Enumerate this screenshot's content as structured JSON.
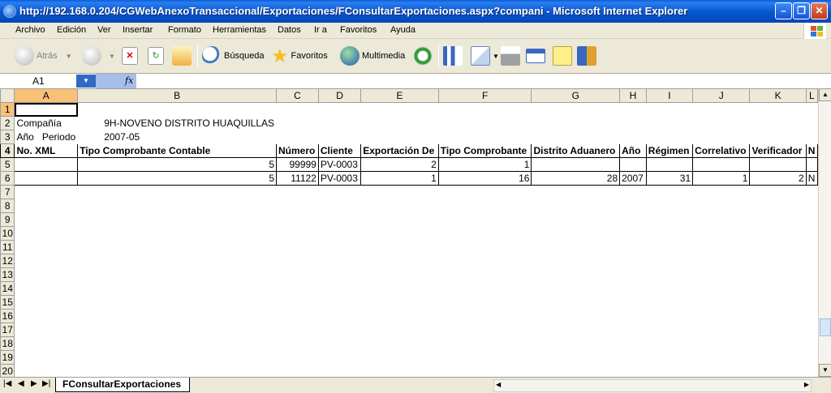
{
  "window": {
    "title": "http://192.168.0.204/CGWebAnexoTransaccional/Exportaciones/FConsultarExportaciones.aspx?compani - Microsoft Internet Explorer",
    "min_icon": "minimize-icon",
    "max_icon": "restore-icon",
    "close_icon": "close-icon"
  },
  "menu": [
    "Archivo",
    "Edición",
    "Ver",
    "Insertar",
    "Formato",
    "Herramientas",
    "Datos",
    "Ir a",
    "Favoritos",
    "Ayuda"
  ],
  "toolbar": {
    "back_label": "Atrás",
    "search_label": "Búsqueda",
    "favorites_label": "Favoritos",
    "media_label": "Multimedia"
  },
  "formula": {
    "namebox": "A1",
    "fx": "fx"
  },
  "sheet": {
    "columns": [
      "A",
      "B",
      "C",
      "D",
      "E",
      "F",
      "G",
      "H",
      "I",
      "J",
      "K",
      "L"
    ],
    "rows": [
      "1",
      "2",
      "3",
      "4",
      "5",
      "6",
      "7",
      "8",
      "9",
      "10",
      "11",
      "12",
      "13",
      "14",
      "15",
      "16",
      "17",
      "18",
      "19",
      "20"
    ],
    "company_label": "Compañía",
    "company_value": "9H-NOVENO DISTRITO HUAQUILLAS",
    "year_label": "Año",
    "period_label": "Periodo",
    "period_value": "2007-05",
    "headers": [
      "No. XML",
      "Tipo Comprobante Contable",
      "Número",
      "Cliente",
      "Exportación De",
      "Tipo Comprobante",
      "Distrito Aduanero",
      "Año",
      "Régimen",
      "Correlativo",
      "Verificador",
      "N"
    ],
    "data": [
      [
        "",
        "5",
        "99999",
        "PV-0003",
        "2",
        "1",
        "",
        "",
        "",
        "",
        "",
        ""
      ],
      [
        "",
        "5",
        "11122",
        "PV-0003",
        "1",
        "16",
        "28",
        "2007",
        "31",
        "1",
        "2",
        "N"
      ]
    ]
  },
  "tabs": {
    "sheet_name": "FConsultarExportaciones"
  },
  "colors": {
    "titlebar": "#0858D0",
    "selected_header": "#F8C178",
    "chrome": "#ECE9D8"
  }
}
